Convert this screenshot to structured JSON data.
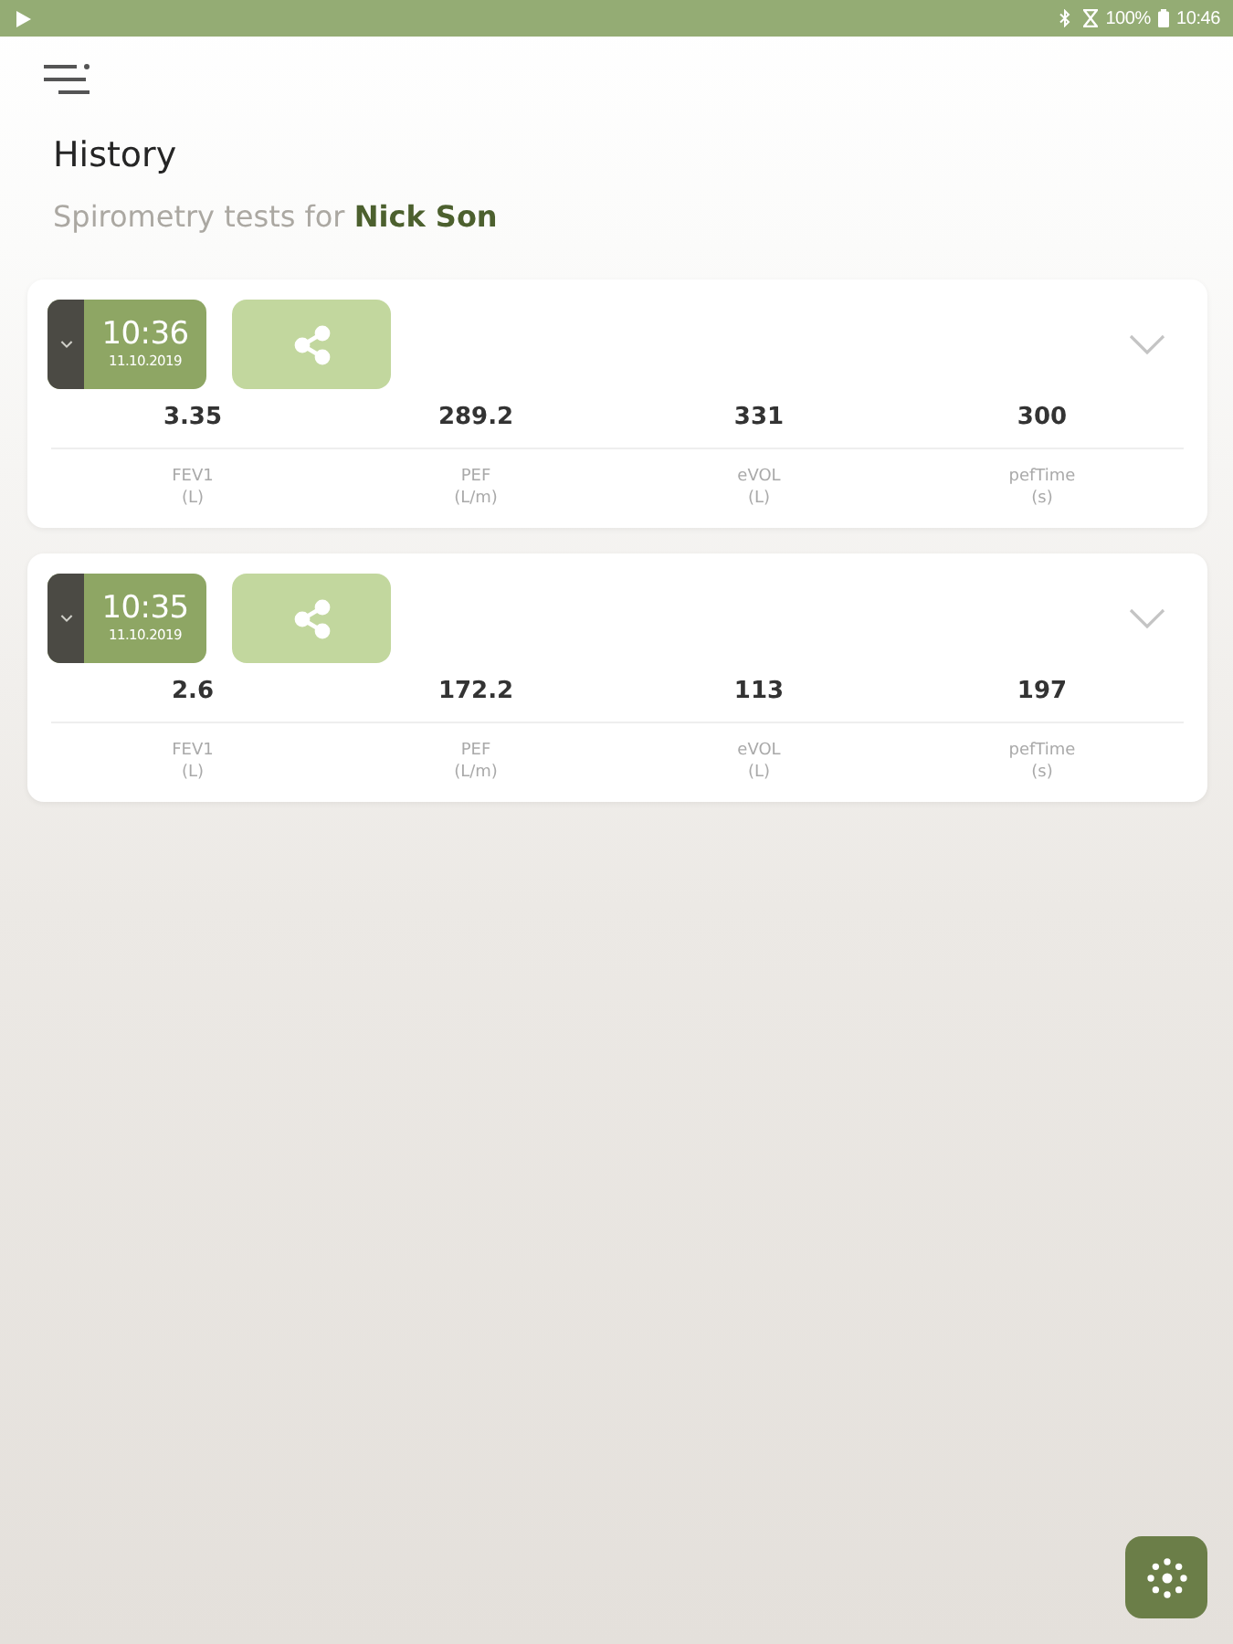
{
  "status_bar": {
    "battery": "100%",
    "time": "10:46"
  },
  "header": {
    "title": "History",
    "subtitle": "Spirometry tests for **Nick Son**"
  },
  "tests": [
    {
      "time": "10:36",
      "date": "11.10.2019",
      "results": [
        {
          "value": "3.35",
          "name": "FEV1",
          "unit": "(L)"
        },
        {
          "value": "289.2",
          "name": "PEF",
          "unit": "(L/m)"
        },
        {
          "value": "331",
          "name": "eVOL",
          "unit": "(L)"
        },
        {
          "value": "300",
          "name": "pefTime",
          "unit": "(s)"
        }
      ]
    },
    {
      "time": "10:35",
      "date": "11.10.2019",
      "results": [
        {
          "value": "2.6",
          "name": "FEV1",
          "unit": "(L)"
        },
        {
          "value": "172.2",
          "name": "PEF",
          "unit": "(L/m)"
        },
        {
          "value": "113",
          "name": "eVOL",
          "unit": "(L)"
        },
        {
          "value": "197",
          "name": "pefTime",
          "unit": "(s)"
        }
      ]
    }
  ]
}
